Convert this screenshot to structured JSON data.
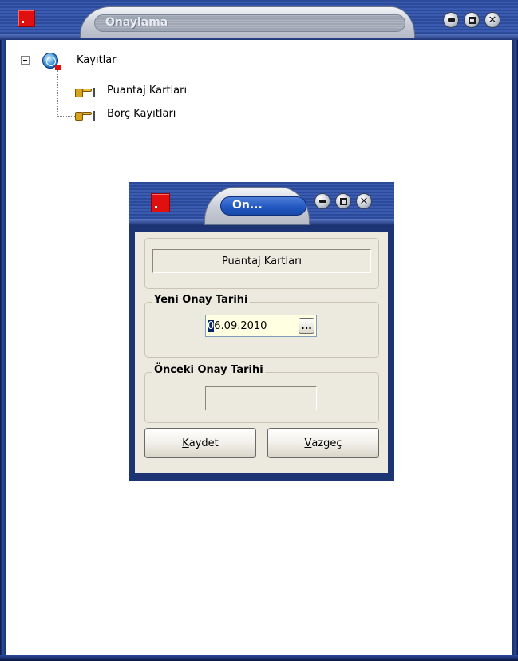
{
  "main_window": {
    "title": "Onaylama",
    "app_icon": "app-red-square-icon",
    "controls": {
      "minimize": "minimize-icon",
      "maximize": "maximize-icon",
      "close": "close-icon"
    }
  },
  "tree": {
    "root": {
      "label": "Kayıtlar",
      "icon": "globe-icon",
      "expanded": true
    },
    "children": [
      {
        "label": "Puantaj Kartları",
        "icon": "pointing-hand-icon"
      },
      {
        "label": "Borç Kayıtları",
        "icon": "pointing-hand-icon"
      }
    ]
  },
  "dialog": {
    "title": "On...",
    "selected_record": "Puantaj Kartları",
    "new_date_group": {
      "label": "Yeni Onay Tarihi",
      "value_first_char": "0",
      "value_rest": "6.09.2010",
      "picker_label": "..."
    },
    "previous_date_group": {
      "label": "Önceki Onay Tarihi",
      "value": ""
    },
    "buttons": {
      "save": {
        "accel": "K",
        "rest": "aydet"
      },
      "cancel": {
        "accel": "V",
        "rest": "azgeç"
      }
    }
  },
  "colors": {
    "title_bar": "#2c4a9a",
    "dialog_tab_active": "#1f56c0",
    "dialog_client": "#ece9df",
    "date_input_bg": "#ffffe1",
    "app_icon": "#e01010"
  }
}
